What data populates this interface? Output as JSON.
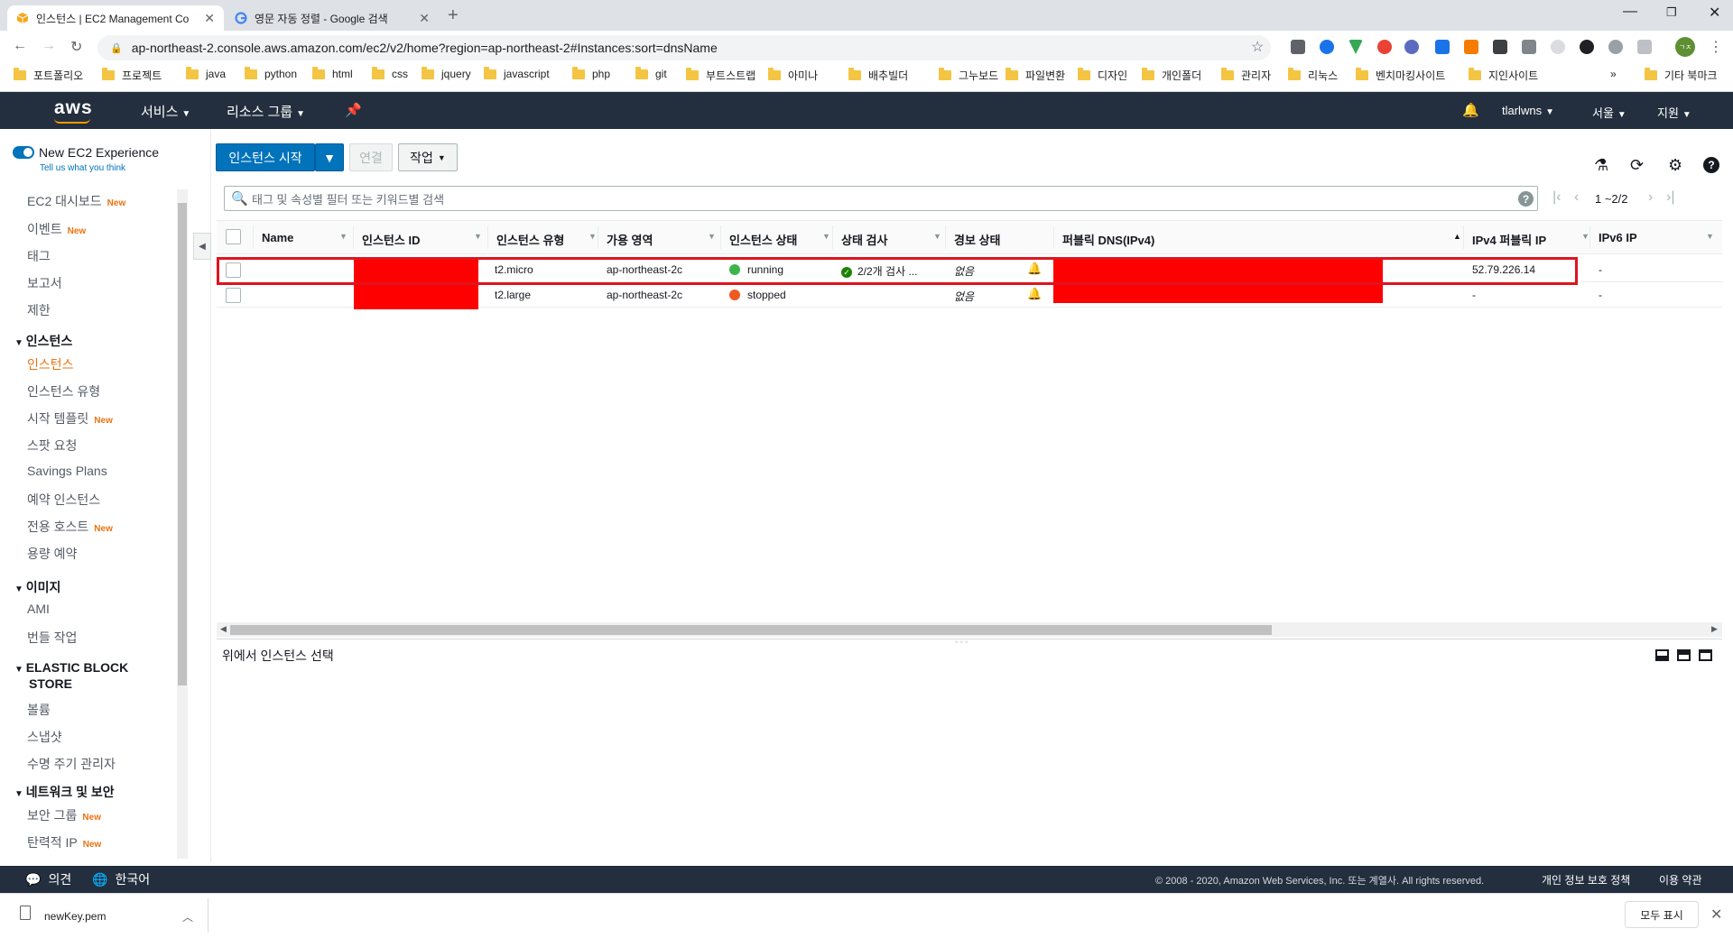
{
  "browser": {
    "tabs": [
      {
        "title": "인스턴스 | EC2 Management Co",
        "active": true
      },
      {
        "title": "영문 자동 정렬 - Google 검색",
        "active": false
      }
    ],
    "url": "ap-northeast-2.console.aws.amazon.com/ec2/v2/home?region=ap-northeast-2#Instances:sort=dnsName",
    "bookmarks": [
      "포트폴리오",
      "프로젝트",
      "java",
      "python",
      "html",
      "css",
      "jquery",
      "javascript",
      "php",
      "git",
      "부트스트랩",
      "아미나",
      "배추빌더",
      "그누보드",
      "파일변환",
      "디자인",
      "개인폴더",
      "관리자",
      "리눅스",
      "벤치마킹사이트",
      "지인사이트"
    ],
    "bookmarks_overflow": "»",
    "other_bookmarks": "기타 북마크",
    "profile_initials": "ㄱㅈ"
  },
  "aws_nav": {
    "logo": "aws",
    "services": "서비스",
    "resource_groups": "리소스 그룹",
    "user": "tlarlwns",
    "region": "서울",
    "support": "지원"
  },
  "sidebar": {
    "new_experience": "New EC2 Experience",
    "tell_us": "Tell us what you think",
    "new_badge": "New",
    "top_items": [
      {
        "label": "EC2 대시보드",
        "new": true
      },
      {
        "label": "이벤트",
        "new": true
      },
      {
        "label": "태그",
        "new": false
      },
      {
        "label": "보고서",
        "new": false
      },
      {
        "label": "제한",
        "new": false
      }
    ],
    "sections": [
      {
        "title": "인스턴스",
        "items": [
          {
            "label": "인스턴스",
            "new": false,
            "active": true
          },
          {
            "label": "인스턴스 유형",
            "new": false
          },
          {
            "label": "시작 템플릿",
            "new": true
          },
          {
            "label": "스팟 요청",
            "new": false
          },
          {
            "label": "Savings Plans",
            "new": false
          },
          {
            "label": "예약 인스턴스",
            "new": false
          },
          {
            "label": "전용 호스트",
            "new": true
          },
          {
            "label": "용량 예약",
            "new": false
          }
        ]
      },
      {
        "title": "이미지",
        "items": [
          {
            "label": "AMI",
            "new": false
          },
          {
            "label": "번들 작업",
            "new": false
          }
        ]
      },
      {
        "title_line1": "ELASTIC BLOCK",
        "title_line2": "STORE",
        "items": [
          {
            "label": "볼륨",
            "new": false
          },
          {
            "label": "스냅샷",
            "new": false
          },
          {
            "label": "수명 주기 관리자",
            "new": false
          }
        ]
      },
      {
        "title": "네트워크 및 보안",
        "items": [
          {
            "label": "보안 그룹",
            "new": true
          },
          {
            "label": "탄력적 IP",
            "new": true
          }
        ]
      }
    ]
  },
  "toolbar": {
    "launch": "인스턴스 시작",
    "connect": "연결",
    "actions": "작업"
  },
  "search": {
    "placeholder": "태그 및 속성별 필터 또는 키워드별 검색",
    "pagination": "1 ~2/2"
  },
  "table": {
    "columns": [
      "Name",
      "인스턴스 ID",
      "인스턴스 유형",
      "가용 영역",
      "인스턴스 상태",
      "상태 검사",
      "경보 상태",
      "퍼블릭 DNS(IPv4)",
      "IPv4 퍼블릭 IP",
      "IPv6 IP"
    ],
    "rows": [
      {
        "name": "",
        "id": "",
        "type": "t2.micro",
        "az": "ap-northeast-2c",
        "state": "running",
        "state_color": "#3cb64a",
        "check": "2/2개 검사 ...",
        "alarm": "없음",
        "dns": "",
        "ipv4": "52.79.226.14",
        "ipv6": "-"
      },
      {
        "name": "",
        "id": "",
        "type": "t2.large",
        "az": "ap-northeast-2c",
        "state": "stopped",
        "state_color": "#ee5a24",
        "check": "",
        "alarm": "없음",
        "dns": "",
        "ipv4": "-",
        "ipv6": "-"
      }
    ]
  },
  "detail": {
    "text": "위에서 인스턴스 선택"
  },
  "footer": {
    "feedback": "의견",
    "language": "한국어",
    "copyright": "© 2008 - 2020, Amazon Web Services, Inc. 또는 계열사. All rights reserved.",
    "privacy": "개인 정보 보호 정책",
    "terms": "이용 약관"
  },
  "download": {
    "file": "newKey.pem",
    "show_all": "모두 표시"
  },
  "colors": {
    "aws_nav": "#232f3e",
    "primary": "#0073bb",
    "accent": "#ec7211",
    "highlight": "#e0141e",
    "redaction": "#ff0000"
  }
}
